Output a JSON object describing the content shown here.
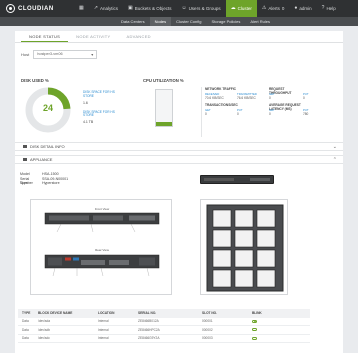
{
  "app": {
    "brand": "CLOUDIAN"
  },
  "topnav": {
    "items": [
      {
        "label": "",
        "icon": "dashboard-icon"
      },
      {
        "label": "Analytics",
        "icon": "analytics-icon"
      },
      {
        "label": "Buckets & Objects",
        "icon": "buckets-icon"
      },
      {
        "label": "Users & Groups",
        "icon": "users-icon"
      },
      {
        "label": "Cluster",
        "icon": "cluster-icon",
        "active": true
      },
      {
        "label": "Alerts",
        "icon": "alert-icon",
        "badge": "0"
      },
      {
        "label": "admin",
        "icon": "user-icon"
      },
      {
        "label": "Help",
        "icon": "help-icon"
      }
    ]
  },
  "subnav": {
    "items": [
      {
        "label": "Data Centers"
      },
      {
        "label": "Nodes",
        "active": true
      },
      {
        "label": "Cluster Config"
      },
      {
        "label": "Storage Policies"
      },
      {
        "label": "Alert Rules"
      }
    ]
  },
  "tabs": [
    {
      "label": "NODE STATUS",
      "active": true
    },
    {
      "label": "NODE ACTIVITY"
    },
    {
      "label": "ADVANCED"
    }
  ],
  "host": {
    "label": "Host",
    "value": "hostper3-vm06"
  },
  "disk": {
    "title": "DISK USED %",
    "percent_label": "24",
    "percent": 24,
    "legend": [
      {
        "label": "DISK SPACE FOR HS STORE",
        "value": "1.6"
      },
      {
        "label": "DISK SPACE FOR HS STORE",
        "value": "4.1 TB"
      }
    ]
  },
  "cpu": {
    "title": "CPU UTILIZATION %",
    "level": 0.1
  },
  "network": {
    "headers": [
      "NETWORK TRAFFIC",
      "",
      "REQUEST THROUGHPUT",
      ""
    ],
    "subs1": [
      "RECEIVED",
      "TRANSMITTED",
      "GET",
      "PUT"
    ],
    "vals1": [
      "70.6 KB/SEC",
      "76.6 KB/SEC",
      "0",
      "0"
    ],
    "headers2": [
      "TRANSACTIONS/SEC",
      "",
      "AVERAGE REQUEST LATENCY (MS)",
      ""
    ],
    "subs2": [
      "GET",
      "PUT",
      "GET",
      "PUT"
    ],
    "vals2": [
      "0",
      "0",
      "0",
      "780"
    ]
  },
  "sections": {
    "disk_detail": "DISK DETAIL INFO",
    "appliance": "APPLIANCE"
  },
  "appliance": {
    "rows": [
      {
        "k": "Model",
        "v": "HSA-1500"
      },
      {
        "k": "Serial Number",
        "v": "SSA-09-N00001"
      },
      {
        "k": "Type",
        "v": "Hyperstore"
      }
    ],
    "diagram_labels": {
      "front": "Front View",
      "rear": "Rear View"
    }
  },
  "table": {
    "headers": [
      "TYPE",
      "BLOCK DEVICE NAME",
      "LOCATION",
      "SERIAL NO.",
      "SLOT NO.",
      "BLINK"
    ],
    "rows": [
      [
        "Data",
        "/dev/sda",
        "Internal",
        "ZE8466B012A",
        "000001",
        true
      ],
      [
        "Data",
        "/dev/sdb",
        "Internal",
        "ZE8466HPC2A",
        "000002",
        false
      ],
      [
        "Data",
        "/dev/sdc",
        "Internal",
        "ZE8466G9Y2A",
        "000003",
        false
      ]
    ]
  },
  "colors": {
    "accent": "#6ea42a",
    "topbar": "#2f3133",
    "link": "#2a8bd0"
  }
}
